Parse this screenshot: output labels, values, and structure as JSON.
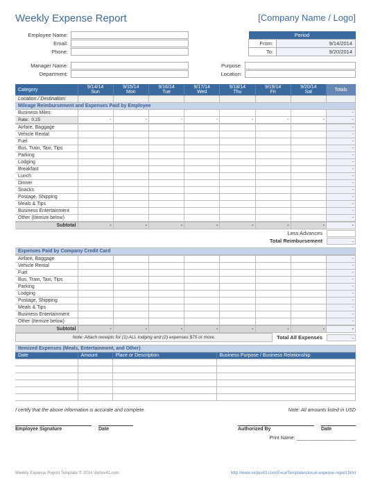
{
  "title": "Weekly Expense Report",
  "company_logo": "[Company Name / Logo]",
  "fields1": {
    "employee_name": "Employee Name:",
    "email": "Email:",
    "phone": "Phone:"
  },
  "fields2": {
    "manager_name": "Manager Name:",
    "department": "Department:",
    "purpose": "Purpose:",
    "location": "Location:"
  },
  "period": {
    "header": "Period",
    "from_label": "From:",
    "from_value": "9/14/2014",
    "to_label": "To:",
    "to_value": "9/20/2014"
  },
  "cat_header": {
    "category": "Category",
    "days": [
      {
        "date": "9/14/14",
        "dow": "Sun"
      },
      {
        "date": "9/15/14",
        "dow": "Mon"
      },
      {
        "date": "9/16/14",
        "dow": "Tue"
      },
      {
        "date": "9/17/14",
        "dow": "Wed"
      },
      {
        "date": "9/18/14",
        "dow": "Thu"
      },
      {
        "date": "9/19/14",
        "dow": "Fri"
      },
      {
        "date": "9/20/14",
        "dow": "Sat"
      }
    ],
    "totals": "Totals"
  },
  "loc_dest": "Location / Destination:",
  "section1": "Mileage Reimbursement and Expenses Paid by Employee",
  "business_miles": "Business Miles:",
  "rate_label": "Rate:",
  "rate_value": "0.25",
  "rows1": [
    "Airfare, Baggage",
    "Vehicle Rental",
    "Fuel",
    "Bus, Train, Taxi, Tips",
    "Parking",
    "Lodging",
    "Breakfast",
    "Lunch",
    "Dinner",
    "Snacks",
    "Postage, Shipping",
    "Meals & Tips",
    "Business Entertainment",
    "Other (Itemize below)"
  ],
  "subtotal": "Subtotal",
  "less_advances": "Less Advances",
  "total_reimb": "Total Reimbursement",
  "section2": "Expenses Paid by Company Credit Card",
  "rows2": [
    "Airfare, Baggage",
    "Vehicle Rental",
    "Fuel",
    "Bus, Train, Taxi, Tips",
    "Parking",
    "Lodging",
    "Postage, Shipping",
    "Meals & Tips",
    "Business Entertainment",
    "Other (Itemize below)"
  ],
  "note_text": "Note: Attach receipts for (1) ALL lodging and (2) expenses $75 or more.",
  "total_all": "Total All Expenses",
  "section3": "Itemized Expenses (Meals, Entertainment, and Other)",
  "item_cols": {
    "date": "Date",
    "amount": "Amount",
    "place": "Place or Description",
    "purpose": "Business Purpose / Business Relationship"
  },
  "cert": "I certify that the above information is accurate and complete.",
  "note_usd": "Note: All amounts listed in USD",
  "sig": {
    "emp": "Employee Signature",
    "date": "Date",
    "auth": "Authorized By",
    "print": "Print Name:"
  },
  "footer": {
    "left": "Weekly Expense Report Template © 2014 Vertex42.com",
    "right": "http://www.vertex42.com/ExcelTemplates/excel-expense-report.html"
  },
  "dash": "-"
}
